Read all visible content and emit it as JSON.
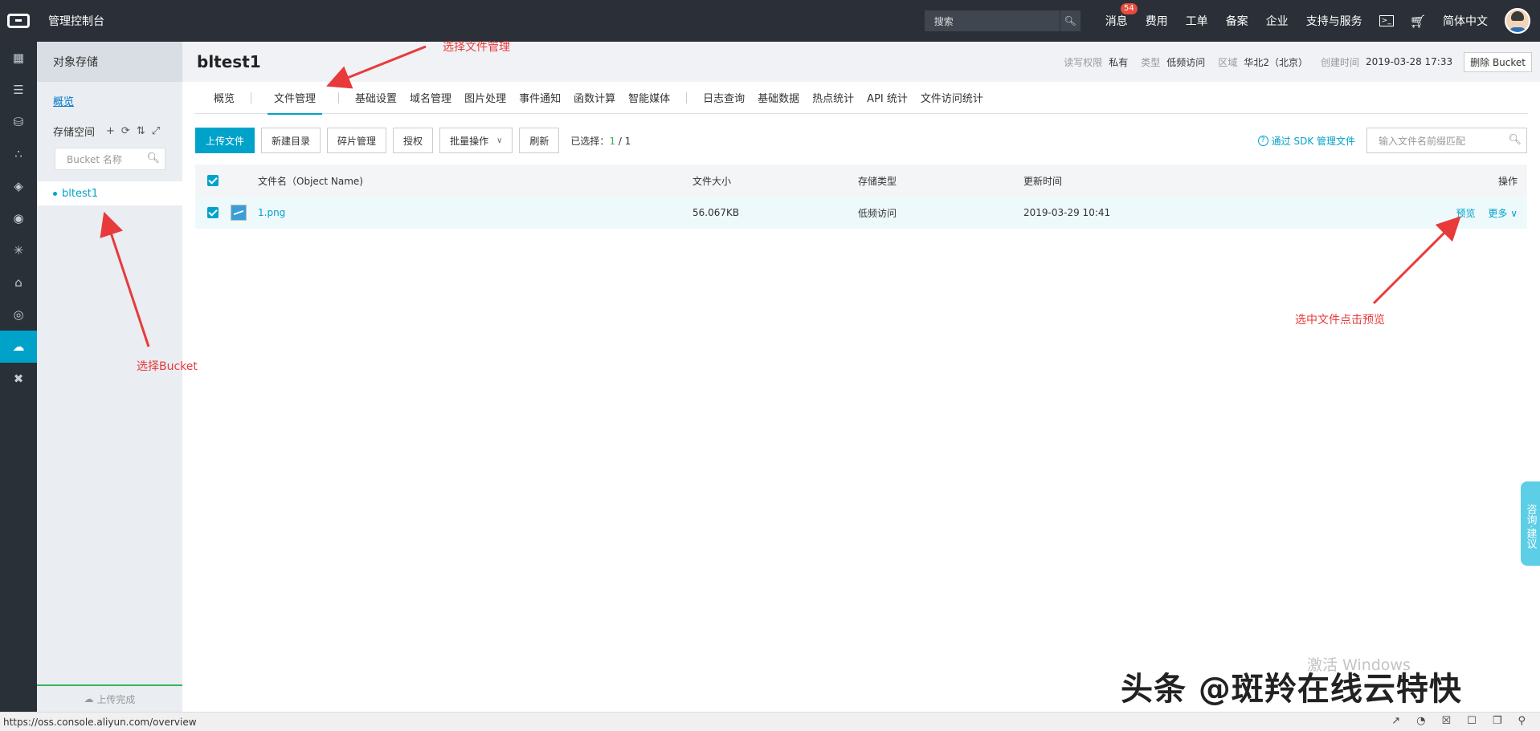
{
  "topbar": {
    "console_title": "管理控制台",
    "search_placeholder": "搜索",
    "nav": [
      {
        "label": "消息",
        "badge": "54"
      },
      {
        "label": "费用"
      },
      {
        "label": "工单"
      },
      {
        "label": "备案"
      },
      {
        "label": "企业"
      },
      {
        "label": "支持与服务"
      }
    ],
    "language": "简体中文"
  },
  "rail": {
    "items": [
      "apps-grid-icon",
      "server-icon",
      "database-icon",
      "network-icon",
      "layers-icon",
      "eye-icon",
      "nodes-icon",
      "bank-icon",
      "shield-icon",
      "cloud-storage-icon",
      "tools-icon"
    ],
    "active_index": 9
  },
  "sidebar": {
    "title": "对象存储",
    "overview": "概览",
    "storage_label": "存储空间",
    "tools": [
      "+",
      "⟳",
      "⇅",
      "⤢"
    ],
    "search_placeholder": "Bucket 名称",
    "buckets": [
      "bltest1"
    ],
    "upload_status": "上传完成"
  },
  "header": {
    "bucket_name": "bltest1",
    "meta": [
      {
        "key": "读写权限",
        "value": "私有"
      },
      {
        "key": "类型",
        "value": "低频访问"
      },
      {
        "key": "区域",
        "value": "华北2（北京）"
      },
      {
        "key": "创建时间",
        "value": "2019-03-28 17:33"
      }
    ],
    "delete_button": "删除 Bucket"
  },
  "tabs": {
    "group1": [
      "概览",
      "文件管理"
    ],
    "group2": [
      "基础设置",
      "域名管理",
      "图片处理",
      "事件通知",
      "函数计算",
      "智能媒体"
    ],
    "group3": [
      "日志查询",
      "基础数据",
      "热点统计",
      "API 统计",
      "文件访问统计"
    ],
    "active": "文件管理"
  },
  "toolbar": {
    "upload": "上传文件",
    "new_dir": "新建目录",
    "fragments": "碎片管理",
    "authorize": "授权",
    "batch": "批量操作",
    "refresh": "刷新",
    "selected_label": "已选择：",
    "selected_count": "1",
    "selected_sep": " / ",
    "selected_total": "1",
    "sdk_link": "通过 SDK 管理文件",
    "search_placeholder": "输入文件名前缀匹配"
  },
  "table": {
    "headers": {
      "name": "文件名（Object Name)",
      "size": "文件大小",
      "type": "存储类型",
      "time": "更新时间",
      "op": "操作"
    },
    "rows": [
      {
        "name": "1.png",
        "size": "56.067KB",
        "type": "低频访问",
        "time": "2019-03-29 10:41",
        "preview": "预览",
        "more": "更多"
      }
    ]
  },
  "annotations": {
    "select_file_mgmt": "选择文件管理",
    "select_bucket": "选择Bucket",
    "select_preview": "选中文件点击预览"
  },
  "consult": "咨询·建议",
  "watermarks": {
    "windows": "激活 Windows",
    "author": "头条 @斑羚在线云特快"
  },
  "statusbar": {
    "url": "https://oss.console.aliyun.com/overview"
  }
}
